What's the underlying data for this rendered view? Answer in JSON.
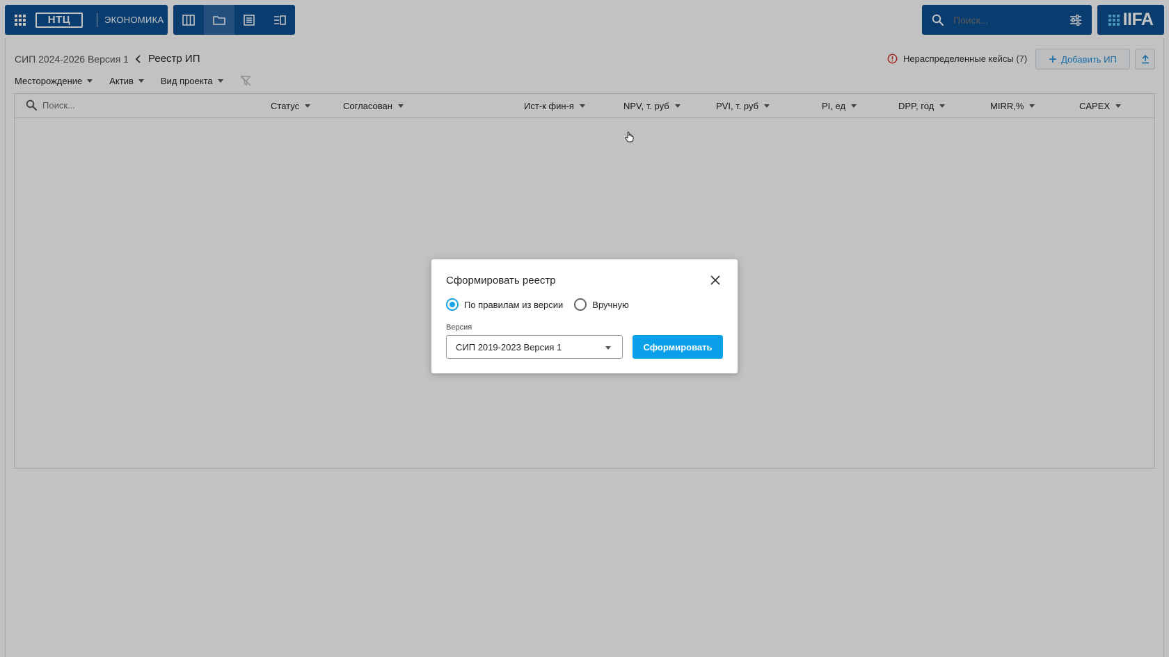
{
  "topbar": {
    "brand_logo": "НТЦ",
    "brand_label": "ЭКОНОМИКА",
    "view_icons": [
      "columns-view-icon",
      "folder-icon",
      "list-icon",
      "split-view-icon"
    ],
    "search_placeholder": "Поиск...",
    "product_logo": "IIFA"
  },
  "breadcrumb": {
    "parent": "СИП 2024-2026 Версия 1",
    "current": "Реестр ИП"
  },
  "actions": {
    "unassigned_cases": "Нераспределенные кейсы (7)",
    "add_button": "Добавить ИП"
  },
  "filters": [
    {
      "label": "Месторождение"
    },
    {
      "label": "Актив"
    },
    {
      "label": "Вид проекта"
    }
  ],
  "table": {
    "search_placeholder": "Поиск...",
    "columns": [
      "Статус",
      "Согласован",
      "Ист-к фин-я",
      "NPV,  т. руб",
      "PVI, т. руб",
      "PI, ед",
      "DPP, год",
      "MIRR,%",
      "CAPEX"
    ]
  },
  "modal": {
    "title": "Сформировать реестр",
    "radio_options": [
      {
        "label": "По правилам из версии",
        "selected": true
      },
      {
        "label": "Вручную",
        "selected": false
      }
    ],
    "version_label": "Версия",
    "version_value": "СИП 2019-2023 Версия 1",
    "submit_label": "Сформировать"
  },
  "colors": {
    "header_blue": "#0d4f93",
    "accent_blue": "#0aa0ea",
    "warning_red": "#d32f2f"
  }
}
